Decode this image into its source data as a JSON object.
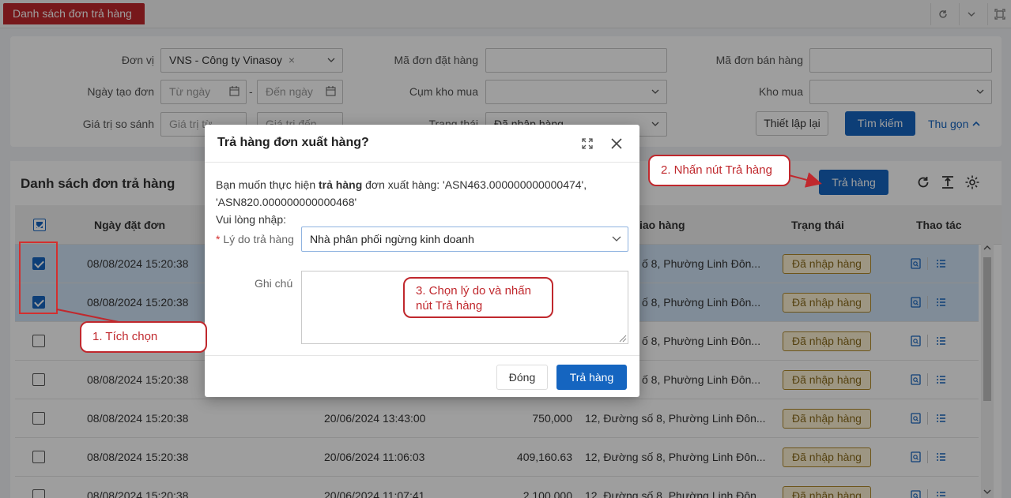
{
  "tab": {
    "title": "Danh sách đơn trả hàng"
  },
  "filter": {
    "don_vi_label": "Đơn vị",
    "don_vi_value": "VNS - Công ty Vinasoy",
    "ngay_tao_label": "Ngày tạo đơn",
    "tu_ngay": "Từ ngày",
    "den_ngay": "Đến ngày",
    "date_sep": "-",
    "gia_tri_label": "Giá trị so sánh",
    "gia_tri_tu": "Giá trị từ",
    "gia_tri_den": "Giá trị đến",
    "ma_don_dat_label": "Mã đơn đặt hàng",
    "cum_kho_label": "Cụm kho mua",
    "trang_thai_label": "Trạng thái",
    "trang_thai_value": "Đã nhập hàng",
    "ma_don_ban_label": "Mã đơn bán hàng",
    "kho_mua_label": "Kho mua",
    "reset_label": "Thiết lập lại",
    "search_label": "Tìm kiếm",
    "collapse_label": "Thu gọn"
  },
  "list": {
    "title": "Danh sách đơn trả hàng",
    "return_button": "Trả hàng",
    "headers": {
      "ngay_dat": "Ngày đặt đơn",
      "giao_hang": "iao hàng",
      "trang_thai": "Trạng thái",
      "thao_tac": "Thao tác"
    },
    "rows": [
      {
        "ngay_dat": "08/08/2024 15:20:38",
        "ngay_2": "",
        "gia_tri": "",
        "dia_chi": "ố 8, Phường Linh Đôn...",
        "trang_thai": "Đã nhập hàng",
        "selected": true
      },
      {
        "ngay_dat": "08/08/2024 15:20:38",
        "ngay_2": "",
        "gia_tri": "",
        "dia_chi": "ố 8, Phường Linh Đôn...",
        "trang_thai": "Đã nhập hàng",
        "selected": true
      },
      {
        "ngay_dat": "08/08/2024 15:20:38",
        "ngay_2": "",
        "gia_tri": "",
        "dia_chi": "ố 8, Phường Linh Đôn...",
        "trang_thai": "Đã nhập hàng",
        "selected": false
      },
      {
        "ngay_dat": "08/08/2024 15:20:38",
        "ngay_2": "",
        "gia_tri": "",
        "dia_chi": "ố 8, Phường Linh Đôn...",
        "trang_thai": "Đã nhập hàng",
        "selected": false
      },
      {
        "ngay_dat": "08/08/2024 15:20:38",
        "ngay_2": "20/06/2024 13:43:00",
        "gia_tri": "750,000",
        "dia_chi": "12, Đường số 8, Phường Linh Đôn...",
        "trang_thai": "Đã nhập hàng",
        "selected": false
      },
      {
        "ngay_dat": "08/08/2024 15:20:38",
        "ngay_2": "20/06/2024 11:06:03",
        "gia_tri": "409,160.63",
        "dia_chi": "12, Đường số 8, Phường Linh Đôn...",
        "trang_thai": "Đã nhập hàng",
        "selected": false
      },
      {
        "ngay_dat": "08/08/2024 15:20:38",
        "ngay_2": "20/06/2024 11:07:41",
        "gia_tri": "2,100,000",
        "dia_chi": "12, Đường số 8, Phường Linh Đôn...",
        "trang_thai": "Đã nhập hàng",
        "selected": false
      }
    ]
  },
  "modal": {
    "title": "Trả hàng đơn xuất hàng?",
    "msg_prefix": "Bạn muốn thực hiện ",
    "msg_bold": "trả hàng",
    "msg_suffix": " đơn xuất hàng: 'ASN463.000000000000474',",
    "msg_line2": "'ASN820.000000000000468'",
    "prompt": "Vui lòng nhập:",
    "required_mark": "*",
    "reason_label": "Lý do trả hàng",
    "reason_value": "Nhà phân phối ngừng kinh doanh",
    "note_label": "Ghi chú",
    "close_button": "Đóng",
    "confirm_button": "Trả hàng"
  },
  "callouts": {
    "step1": "1. Tích chọn",
    "step2": "2. Nhấn nút Trả hàng",
    "step3_line1": "3. Chọn lý do và nhấn",
    "step3_line2": "nút Trả hàng"
  },
  "colors": {
    "brand_red": "#c0282d",
    "primary": "#1565c0",
    "badge_border": "#b08a2a"
  }
}
